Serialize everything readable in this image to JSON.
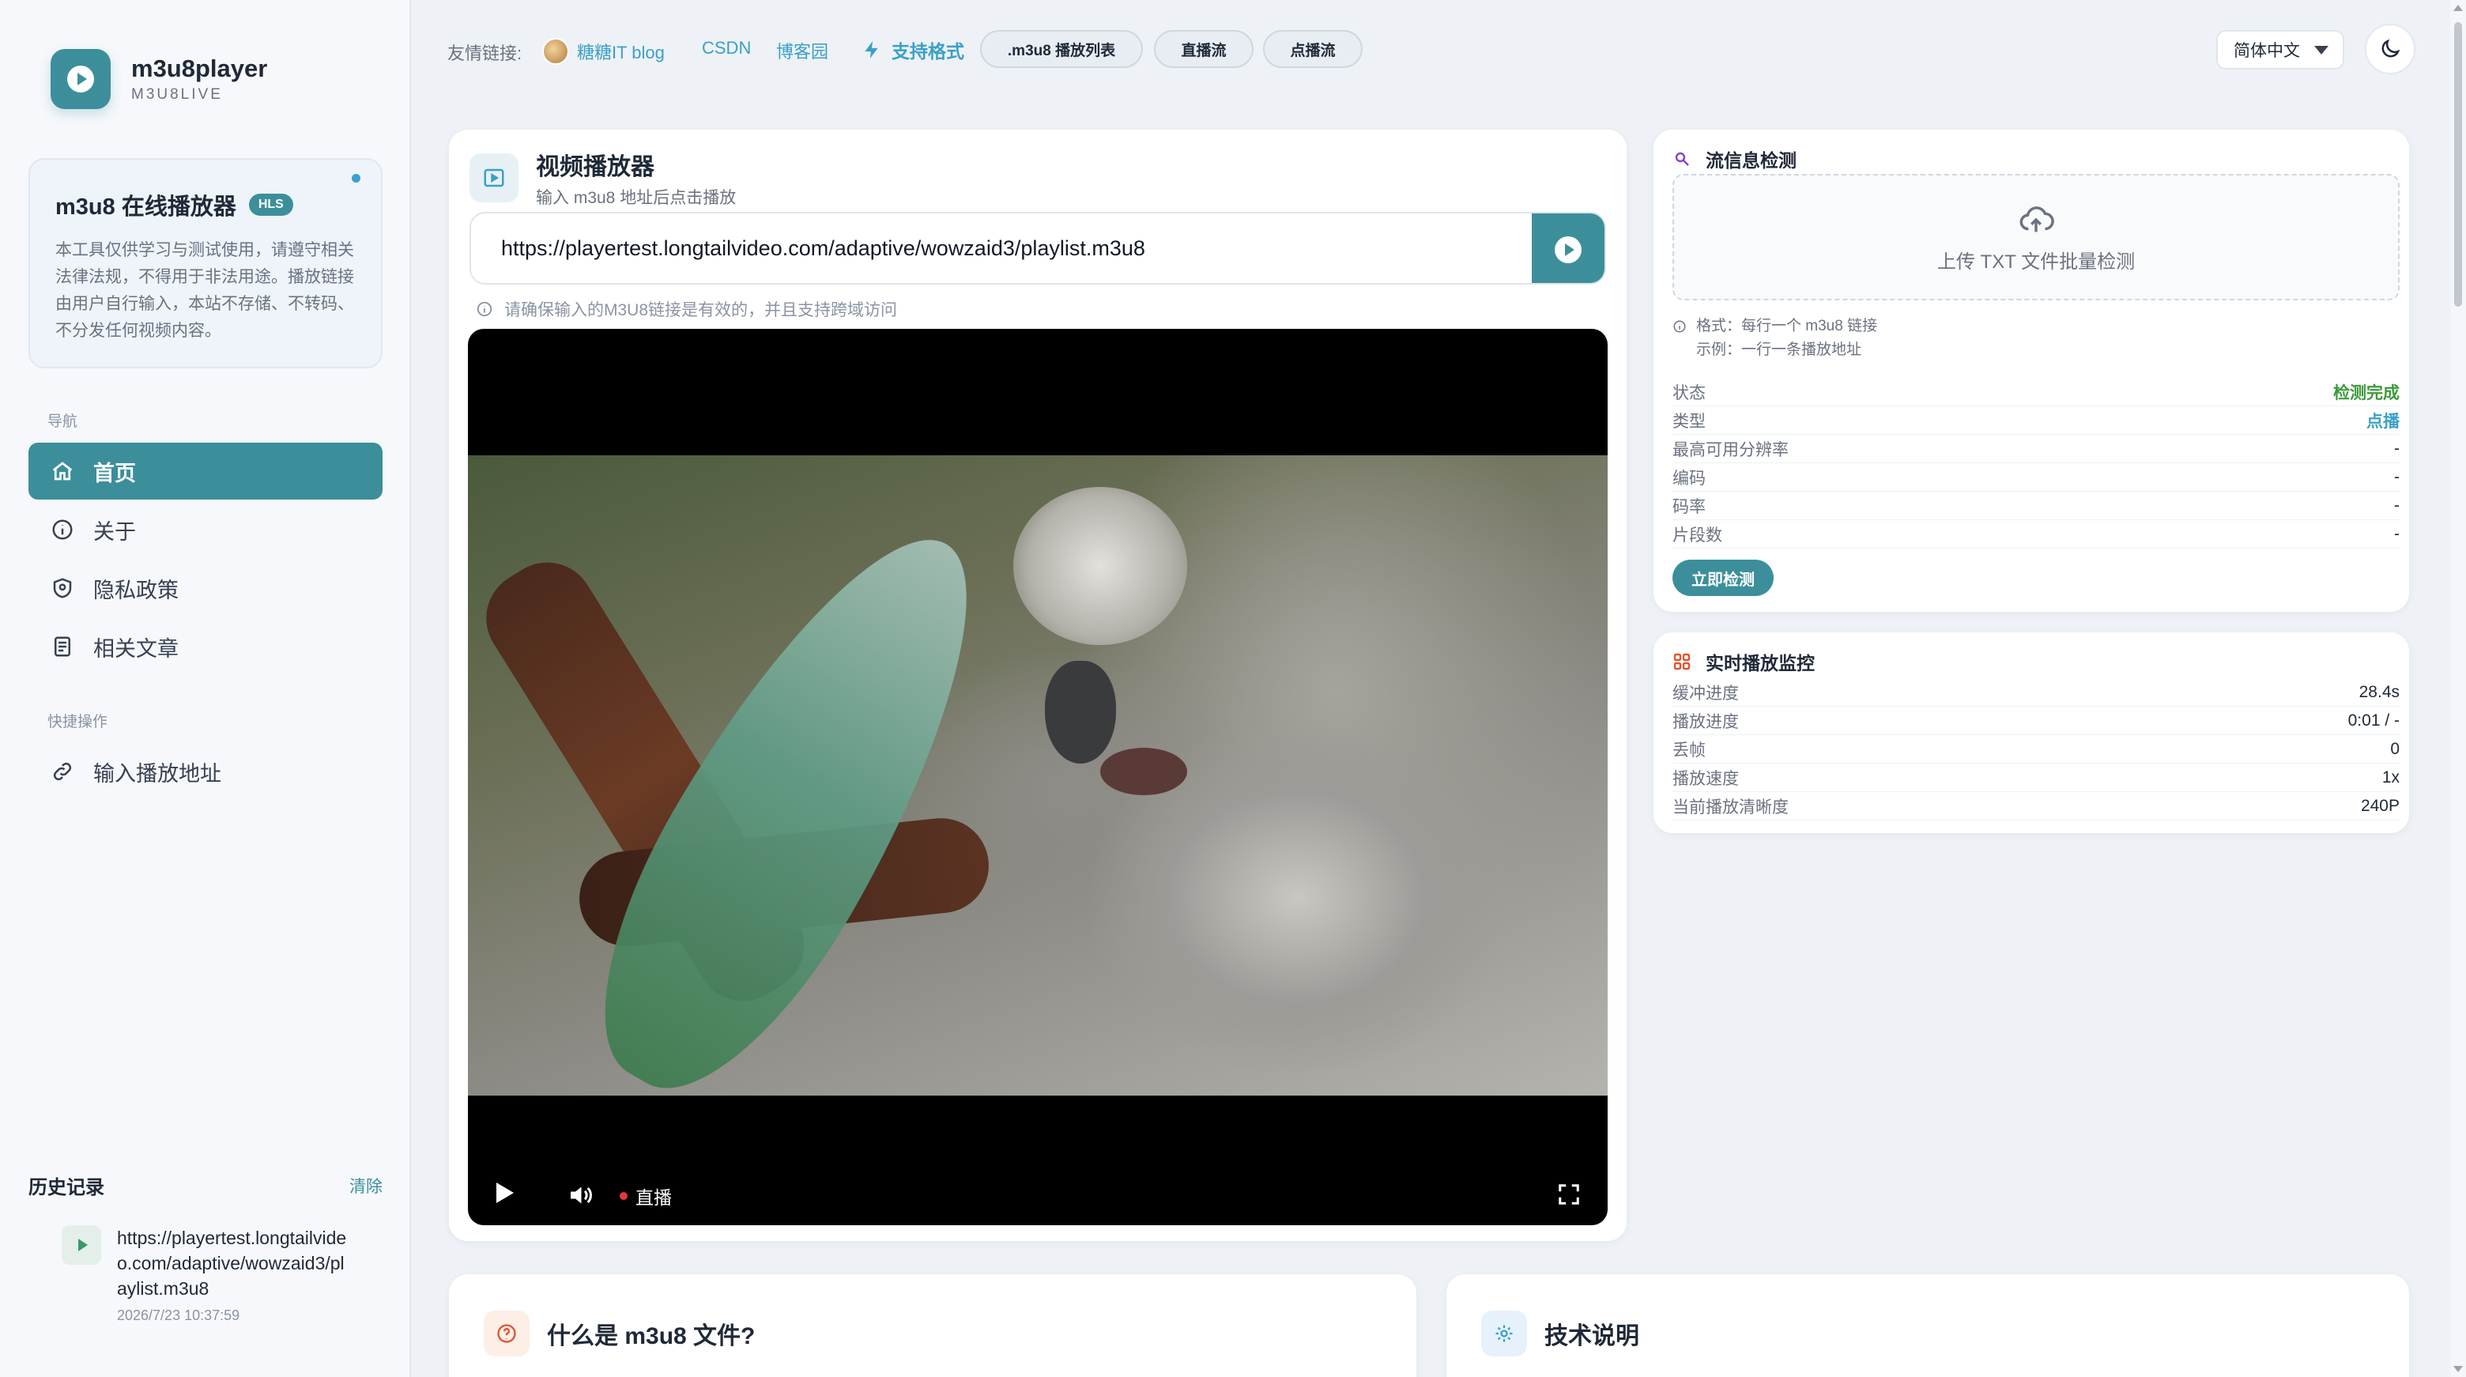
{
  "brand": {
    "name": "m3u8player",
    "sub": "M3U8LIVE"
  },
  "intro": {
    "title": "m3u8 在线播放器",
    "badge": "HLS",
    "desc": "本工具仅供学习与测试使用，请遵守相关法律法规，不得用于非法用途。播放链接由用户自行输入，本站不存储、不转码、不分发任何视频内容。"
  },
  "nav": {
    "label": "导航",
    "items": [
      {
        "label": "首页",
        "icon": "home-icon",
        "active": true
      },
      {
        "label": "关于",
        "icon": "info-icon",
        "active": false
      },
      {
        "label": "隐私政策",
        "icon": "shield-icon",
        "active": false
      },
      {
        "label": "相关文章",
        "icon": "article-icon",
        "active": false
      }
    ],
    "quick_label": "快捷操作",
    "quick_items": [
      {
        "label": "输入播放地址",
        "icon": "link-icon"
      }
    ]
  },
  "history": {
    "title": "历史记录",
    "clear": "清除",
    "items": [
      {
        "url": "https://playertest.longtailvideo.com/adaptive/wowzaid3/playlist.m3u8",
        "time": "2026/7/23 10:37:59"
      }
    ]
  },
  "topbar": {
    "friend_label": "友情链接:",
    "links": [
      "糖糖IT blog",
      "CSDN",
      "博客园"
    ],
    "formats_label": "支持格式",
    "chips": [
      ".m3u8 播放列表",
      "直播流",
      "点播流"
    ],
    "language": "简体中文"
  },
  "player": {
    "title": "视频播放器",
    "subtitle": "输入 m3u8 地址后点击播放",
    "url": "https://playertest.longtailvideo.com/adaptive/wowzaid3/playlist.m3u8",
    "hint": "请确保输入的M3U8链接是有效的，并且支持跨域访问",
    "live_label": "直播"
  },
  "detect": {
    "title": "流信息检测",
    "upload": "上传 TXT 文件批量检测",
    "format_note": "格式：每行一个 m3u8 链接",
    "example_note": "示例：一行一条播放地址",
    "rows": [
      {
        "k": "状态",
        "v": "检测完成",
        "style": "green"
      },
      {
        "k": "类型",
        "v": "点播",
        "style": "blue"
      },
      {
        "k": "最高可用分辨率",
        "v": "-",
        "style": ""
      },
      {
        "k": "编码",
        "v": "-",
        "style": ""
      },
      {
        "k": "码率",
        "v": "-",
        "style": ""
      },
      {
        "k": "片段数",
        "v": "-",
        "style": ""
      }
    ],
    "button": "立即检测"
  },
  "monitor": {
    "title": "实时播放监控",
    "rows": [
      {
        "k": "缓冲进度",
        "v": "28.4s"
      },
      {
        "k": "播放进度",
        "v": "0:01 / -"
      },
      {
        "k": "丢帧",
        "v": "0"
      },
      {
        "k": "播放速度",
        "v": "1x"
      },
      {
        "k": "当前播放清晰度",
        "v": "240P"
      }
    ]
  },
  "bottom": {
    "what_title": "什么是 m3u8 文件?",
    "tech_title": "技术说明"
  },
  "colors": {
    "accent": "#3c8f9a",
    "link": "#3ba0c6",
    "success": "#3b9a3b"
  }
}
